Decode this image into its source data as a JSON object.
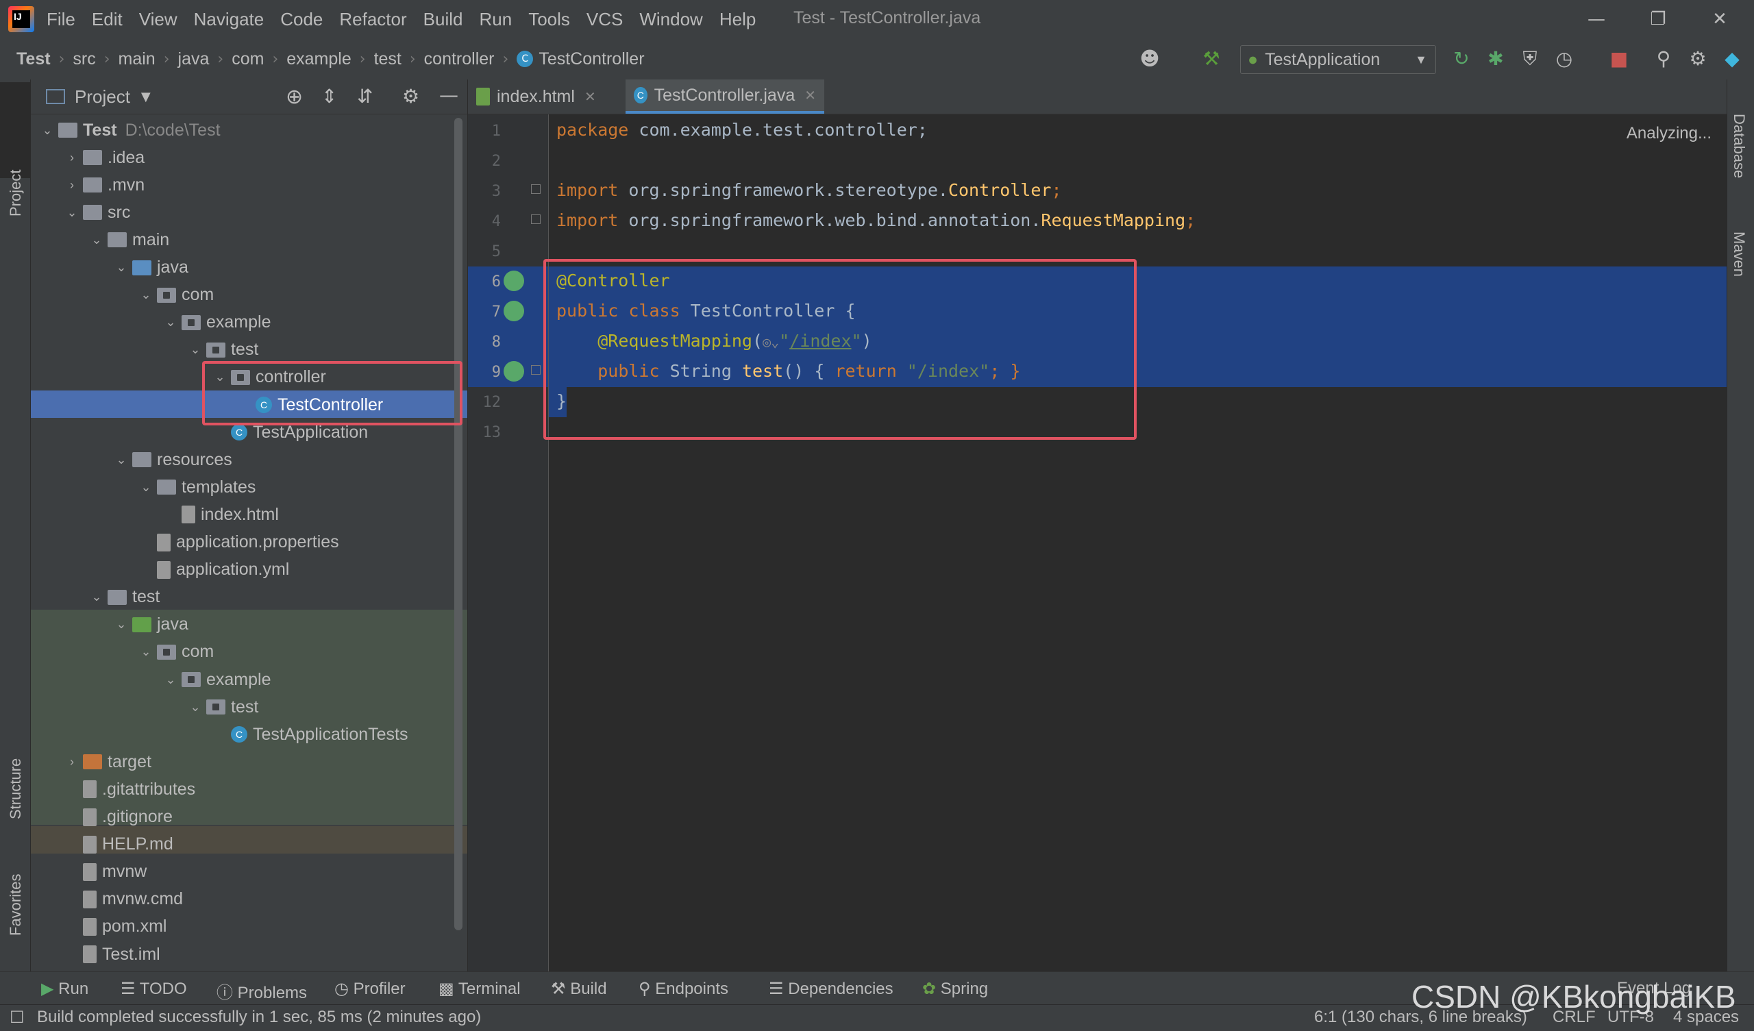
{
  "menubar": {
    "items": [
      "File",
      "Edit",
      "View",
      "Navigate",
      "Code",
      "Refactor",
      "Build",
      "Run",
      "Tools",
      "VCS",
      "Window",
      "Help"
    ],
    "window_title": "Test - TestController.java"
  },
  "navbar": {
    "crumbs": [
      "Test",
      "src",
      "main",
      "java",
      "com",
      "example",
      "test",
      "controller",
      "TestController"
    ],
    "run_config": "TestApplication"
  },
  "left_stripe": {
    "project": "Project",
    "structure": "Structure",
    "favorites": "Favorites"
  },
  "right_stripe": {
    "database": "Database",
    "maven": "Maven"
  },
  "project_panel": {
    "title": "Project",
    "root_name": "Test",
    "root_path": "D:\\code\\Test",
    "items": [
      {
        "label": ".idea"
      },
      {
        "label": ".mvn"
      },
      {
        "label": "src"
      },
      {
        "label": "main"
      },
      {
        "label": "java"
      },
      {
        "label": "com"
      },
      {
        "label": "example"
      },
      {
        "label": "test"
      },
      {
        "label": "controller"
      },
      {
        "label": "TestController"
      },
      {
        "label": "TestApplication"
      },
      {
        "label": "resources"
      },
      {
        "label": "templates"
      },
      {
        "label": "index.html"
      },
      {
        "label": "application.properties"
      },
      {
        "label": "application.yml"
      },
      {
        "label": "test"
      },
      {
        "label": "java"
      },
      {
        "label": "com"
      },
      {
        "label": "example"
      },
      {
        "label": "test"
      },
      {
        "label": "TestApplicationTests"
      },
      {
        "label": "target"
      },
      {
        "label": ".gitattributes"
      },
      {
        "label": ".gitignore"
      },
      {
        "label": "HELP.md"
      },
      {
        "label": "mvnw"
      },
      {
        "label": "mvnw.cmd"
      },
      {
        "label": "pom.xml"
      },
      {
        "label": "Test.iml"
      }
    ]
  },
  "editor": {
    "tabs": [
      {
        "label": "index.html"
      },
      {
        "label": "TestController.java"
      }
    ],
    "status": "Analyzing...",
    "line_numbers": [
      "1",
      "2",
      "3",
      "4",
      "5",
      "6",
      "7",
      "8",
      "9",
      "12",
      "13"
    ],
    "lines": {
      "l1_kw": "package",
      "l1_rest": " com.example.test.controller;",
      "l3_kw": "import",
      "l3_rest": " org.springframework.stereotype.",
      "l3_cls": "Controller",
      "l3_end": ";",
      "l4_kw": "import",
      "l4_rest": " org.springframework.web.bind.annotation.",
      "l4_cls": "RequestMapping",
      "l4_end": ";",
      "l6_ann": "@Controller",
      "l7_kw": "public class",
      "l7_rest": " TestController {",
      "l8_ann": "@RequestMapping",
      "l8_open": "(",
      "l8_q1": "\"",
      "l8_url": "/index",
      "l8_q2": "\"",
      "l8_close": ")",
      "l9_kw": "public",
      "l9_type": " String ",
      "l9_fn": "test",
      "l9_mid": "() { ",
      "l9_ret": "return",
      "l9_str": " \"/index\"",
      "l9_end": "; }",
      "l12": "}"
    }
  },
  "bottom_tools": [
    "Run",
    "TODO",
    "Problems",
    "Profiler",
    "Terminal",
    "Build",
    "Endpoints",
    "Dependencies",
    "Spring",
    "Event Log"
  ],
  "status_bar": {
    "message": "Build completed successfully in 1 sec, 85 ms (2 minutes ago)",
    "position": "6:1 (130 chars, 6 line breaks)",
    "line_sep": "CRLF",
    "encoding": "UTF-8",
    "indent": "4 spaces"
  },
  "watermark": "CSDN @KBkongbaiKB",
  "colors": {
    "highlight": "#e05361",
    "selection": "#214283",
    "accent": "#4b6eaf"
  }
}
